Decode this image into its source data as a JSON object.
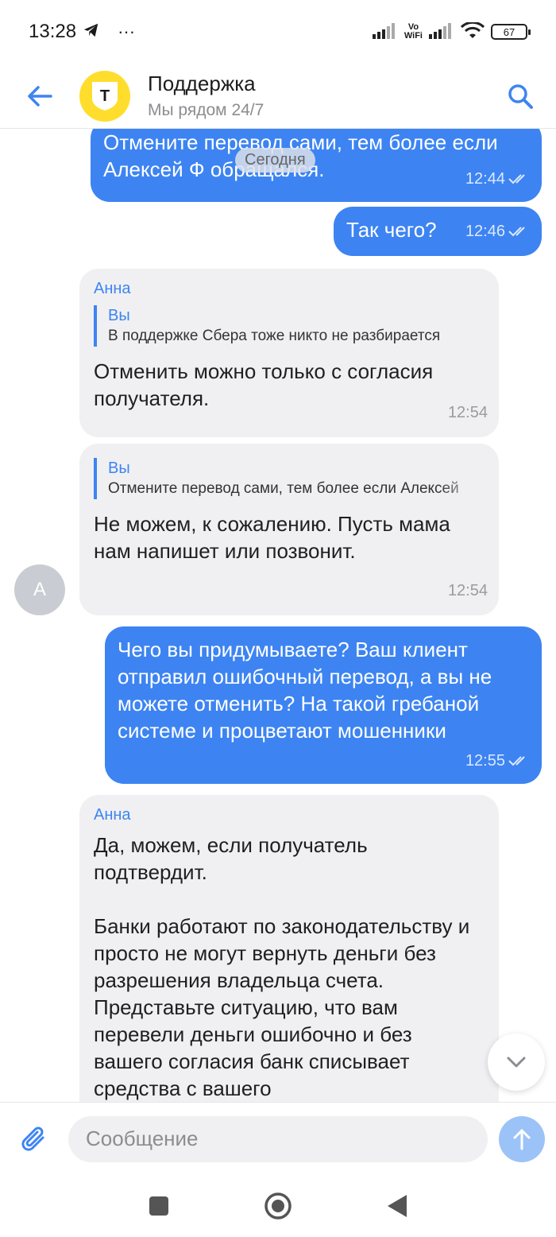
{
  "status_bar": {
    "time": "13:28",
    "more": "···",
    "vowifi": "Vo\nWiFi",
    "battery": "67"
  },
  "header": {
    "title": "Поддержка",
    "subtitle": "Мы рядом 24/7",
    "logo_letter": "Т",
    "icons": {
      "back": "arrow-left-icon",
      "search": "search-icon"
    }
  },
  "chat": {
    "date_divider": "Сегодня",
    "messages": [
      {
        "direction": "out",
        "text": "Отмените перевод сами, тем более если Алексей Ф обращался.",
        "time": "12:44",
        "status": "read"
      },
      {
        "direction": "out",
        "text": "Так чего?",
        "time": "12:46",
        "status": "read"
      },
      {
        "direction": "in",
        "sender": "Анна",
        "quote_author": "Вы",
        "quote_text": "В поддержке Сбера тоже никто не разбирается",
        "text": "Отменить можно только с согласия получателя.",
        "time": "12:54"
      },
      {
        "direction": "in",
        "quote_author": "Вы",
        "quote_text": "Отмените перевод сами, тем более если Алексей",
        "text": "Не можем, к сожалению. Пусть мама нам напишет или позвонит.",
        "time": "12:54"
      },
      {
        "direction": "out",
        "text": "Чего вы придумываете? Ваш клиент отправил ошибочный перевод, а вы не можете отменить? На такой гребаной системе и процветают мошенники",
        "time": "12:55",
        "status": "read"
      },
      {
        "direction": "in",
        "sender": "Анна",
        "text": "Да, можем, если получатель подтвердит.\n\nБанки работают по законодательству и просто не могут вернуть деньги без разрешения владельца счета. Представьте ситуацию, что вам перевели деньги ошибочно и без вашего согласия банк списывает средства с вашего"
      }
    ],
    "sender_avatar_letter": "А"
  },
  "input": {
    "placeholder": "Сообщение",
    "value": ""
  },
  "colors": {
    "accent": "#3d84f2",
    "incoming_bg": "#f0f0f2",
    "logo_yellow": "#ffdd2d"
  }
}
